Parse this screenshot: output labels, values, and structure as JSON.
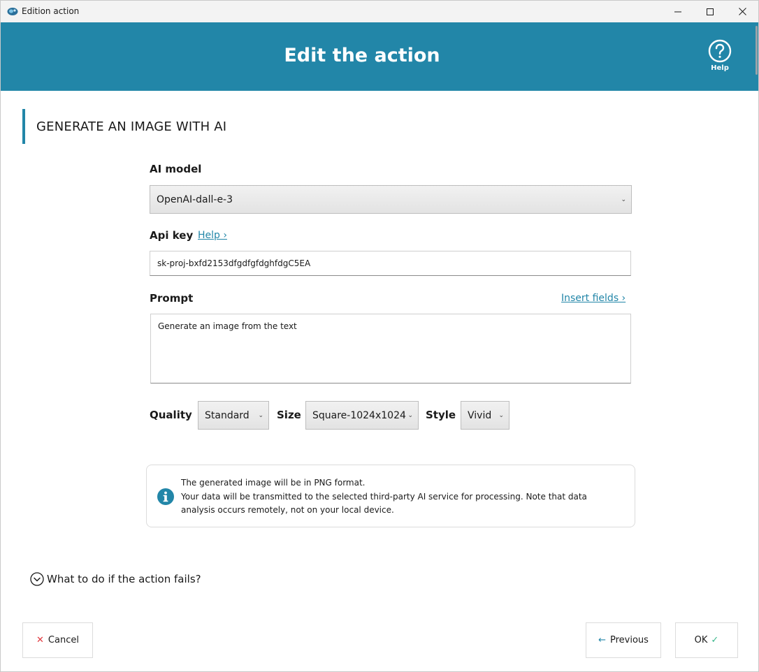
{
  "window": {
    "title": "Edition action"
  },
  "header": {
    "title": "Edit the action",
    "help_label": "Help"
  },
  "section": {
    "title": "GENERATE AN IMAGE WITH AI"
  },
  "form": {
    "ai_model_label": "AI model",
    "ai_model_value": "OpenAI-dall-e-3",
    "api_key_label": "Api key",
    "api_key_help_link": "Help ›",
    "api_key_value": "sk-proj-bxfd2153dfgdfgfdghfdgC5EA",
    "prompt_label": "Prompt",
    "insert_fields_link": "Insert fields ›",
    "prompt_value": "Generate an image from the text",
    "quality_label": "Quality",
    "quality_value": "Standard",
    "size_label": "Size",
    "size_value": "Square-1024x1024",
    "style_label": "Style",
    "style_value": "Vivid"
  },
  "info": {
    "line1": "The generated image will be in PNG format.",
    "line2": "Your data will be transmitted to the selected third-party AI service for processing. Note that data analysis occurs remotely, not on your local device."
  },
  "fail": {
    "label": "What to do if the action fails?"
  },
  "buttons": {
    "cancel": "Cancel",
    "previous": "Previous",
    "ok": "OK"
  },
  "colors": {
    "accent": "#2286a8",
    "cancel_x": "#e0383e",
    "ok_check": "#3bb88c"
  }
}
